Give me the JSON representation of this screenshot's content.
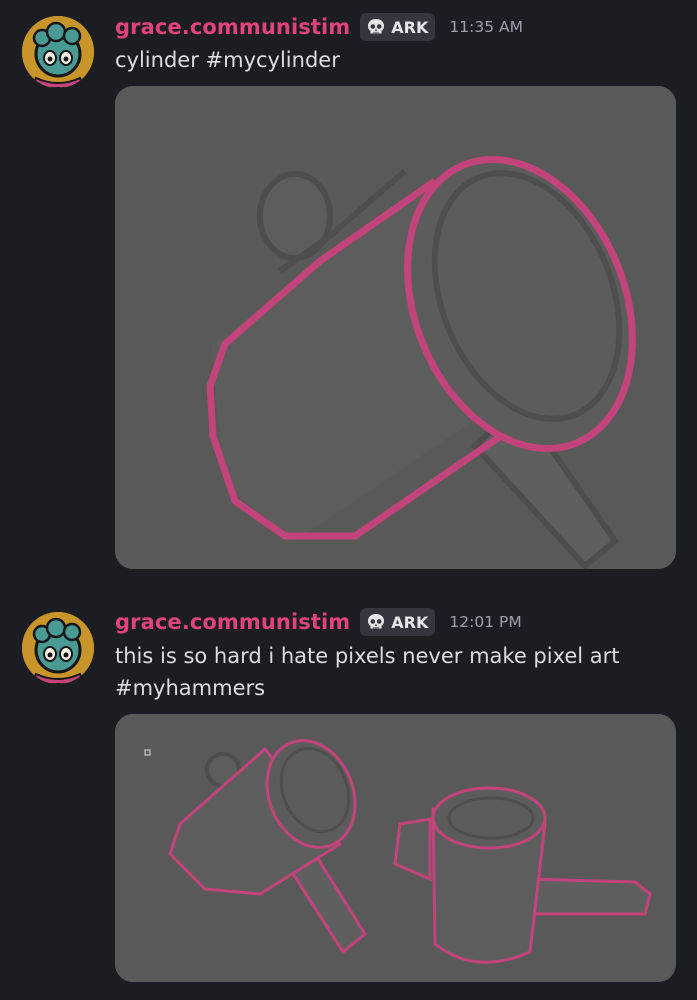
{
  "messages": [
    {
      "username": "grace.communistim",
      "tag_label": "ARK",
      "tag_icon": "skull-icon",
      "timestamp": "11:35 AM",
      "text": "cylinder #mycylinder",
      "attachment": "pixel-art-image"
    },
    {
      "username": "grace.communistim",
      "tag_label": "ARK",
      "tag_icon": "skull-icon",
      "timestamp": "12:01 PM",
      "text": "this is so hard i hate pixels never make pixel art #myhammers",
      "attachment": "pixel-art-image"
    }
  ],
  "colors": {
    "background": "#1c1d22",
    "username": "#e0447a",
    "image_background": "#595959",
    "pixel_line": "#c2447a",
    "tag_background": "#34363d"
  }
}
